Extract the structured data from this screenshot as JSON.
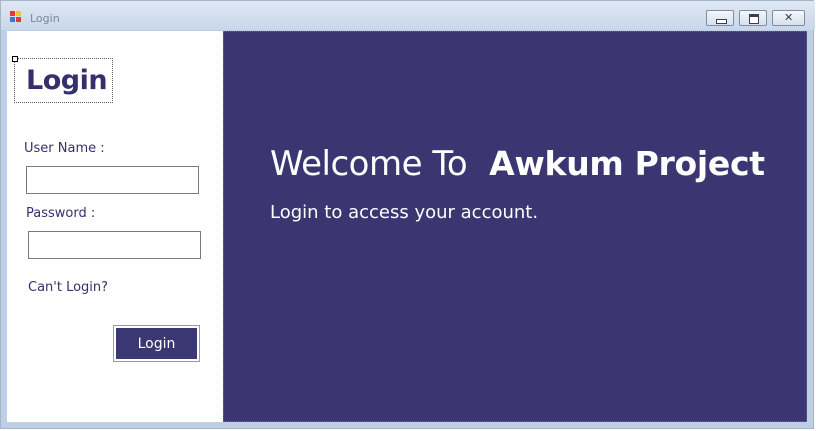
{
  "window": {
    "title": "Login"
  },
  "colors": {
    "brand": "#3b3672",
    "titlebar": "#c9d7ea"
  },
  "left_panel": {
    "heading": "Login",
    "username_label": "User Name :",
    "username_value": "",
    "password_label": "Password :",
    "password_value": "",
    "forgot_link": "Can't Login?",
    "login_button": "Login"
  },
  "right_panel": {
    "welcome_prefix": "Welcome To",
    "project_name": "Awkum Project",
    "subtitle": "Login to access your account."
  },
  "icons": [
    "app-icon",
    "minimize-icon",
    "maximize-icon",
    "close-icon"
  ]
}
